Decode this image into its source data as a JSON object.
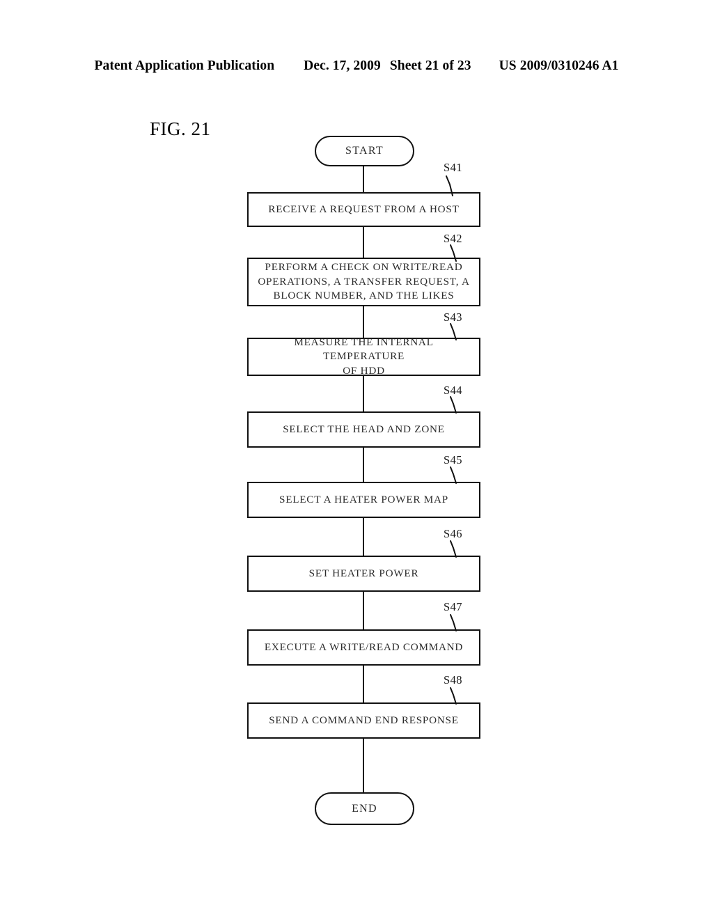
{
  "header": {
    "publication": "Patent Application Publication",
    "date": "Dec. 17, 2009",
    "sheet": "Sheet 21 of 23",
    "patent_number": "US 2009/0310246 A1"
  },
  "figure": {
    "label": "FIG. 21"
  },
  "flowchart": {
    "start_label": "START",
    "end_label": "END",
    "steps": [
      {
        "id": "S41",
        "text": "RECEIVE A REQUEST FROM A HOST"
      },
      {
        "id": "S42",
        "text": "PERFORM A CHECK ON WRITE/READ\nOPERATIONS, A TRANSFER REQUEST, A\nBLOCK NUMBER, AND THE LIKES"
      },
      {
        "id": "S43",
        "text": "MEASURE THE INTERNAL TEMPERATURE\nOF HDD"
      },
      {
        "id": "S44",
        "text": "SELECT THE HEAD AND ZONE"
      },
      {
        "id": "S45",
        "text": "SELECT A HEATER POWER MAP"
      },
      {
        "id": "S46",
        "text": "SET HEATER POWER"
      },
      {
        "id": "S47",
        "text": "EXECUTE A WRITE/READ COMMAND"
      },
      {
        "id": "S48",
        "text": "SEND A COMMAND END RESPONSE"
      }
    ]
  }
}
